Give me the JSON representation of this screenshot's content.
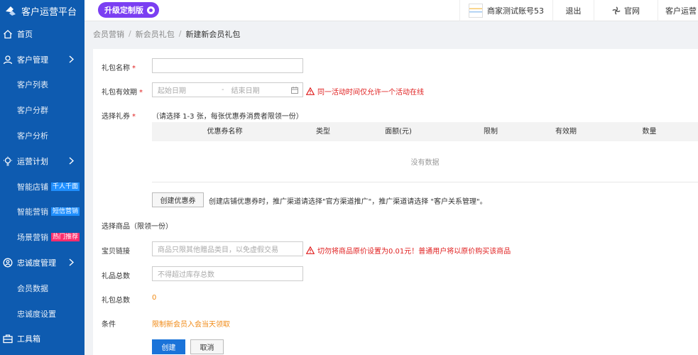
{
  "app": {
    "title": "客户运营平台",
    "upgrade_label": "升级定制版"
  },
  "topbar": {
    "account": "商家测试账号53",
    "logout": "退出",
    "site": "官网",
    "platform_cut": "客户运营"
  },
  "sidebar": {
    "items": [
      {
        "label": "首页",
        "icon": "home-icon"
      },
      {
        "label": "客户管理",
        "icon": "customer-icon"
      },
      {
        "label": "客户列表"
      },
      {
        "label": "客户分群"
      },
      {
        "label": "客户分析"
      },
      {
        "label": "运营计划",
        "icon": "bulb-icon"
      },
      {
        "label": "智能店铺",
        "tag": "千人千面",
        "tag_color": "#1f8fff"
      },
      {
        "label": "智能营销",
        "tag": "短信营销",
        "tag_color": "#1f8fff"
      },
      {
        "label": "场景营销",
        "tag": "热门推荐",
        "tag_color": "#ff2d6d"
      },
      {
        "label": "忠诚度管理",
        "icon": "loyalty-icon"
      },
      {
        "label": "会员数据"
      },
      {
        "label": "忠诚度设置"
      },
      {
        "label": "工具箱",
        "icon": "toolbox-icon"
      }
    ]
  },
  "breadcrumb": [
    "会员营销",
    "新会员礼包",
    "新建新会员礼包"
  ],
  "form": {
    "name_label": "礼包名称",
    "validity_label": "礼包有效期",
    "start_placeholder": "起始日期",
    "range_sep": "-",
    "end_placeholder": "结束日期",
    "validity_warning": "同一活动时间仅允许一个活动在线",
    "coupon_label": "选择礼券",
    "coupon_hint": "（请选择 1-3 张，每张优惠券消费者限领一份）",
    "columns": [
      "优惠券名称",
      "类型",
      "面额(元)",
      "限制",
      "有效期",
      "数量"
    ],
    "empty_text": "没有数据",
    "create_coupon_button": "创建优惠券",
    "create_coupon_hint": "创建店铺优惠券时，推广渠道请选择\"官方渠道推广\"，推广渠道请选择 \"客户关系管理\"。",
    "product_label": "选择商品（限领一份）",
    "item_link_label": "宝贝链接",
    "item_link_placeholder": "商品只限其他赠品类目，以免虚假交易",
    "item_link_warning": "切勿将商品原价设置为0.01元！普通用户将以原价购买该商品",
    "gift_total_label": "礼品总数",
    "gift_total_placeholder": "不得超过库存总数",
    "pack_total_label": "礼包总数",
    "pack_total_value": "0",
    "condition_label": "条件",
    "condition_value": "限制新会员入会当天领取",
    "submit_button": "创建",
    "cancel_button": "取消"
  },
  "colors": {
    "sidebar": "#0e5bb0",
    "upgrade": "#7b3ff2",
    "primary": "#1a73d9",
    "warning": "#e02020",
    "orange": "#f08a16"
  }
}
